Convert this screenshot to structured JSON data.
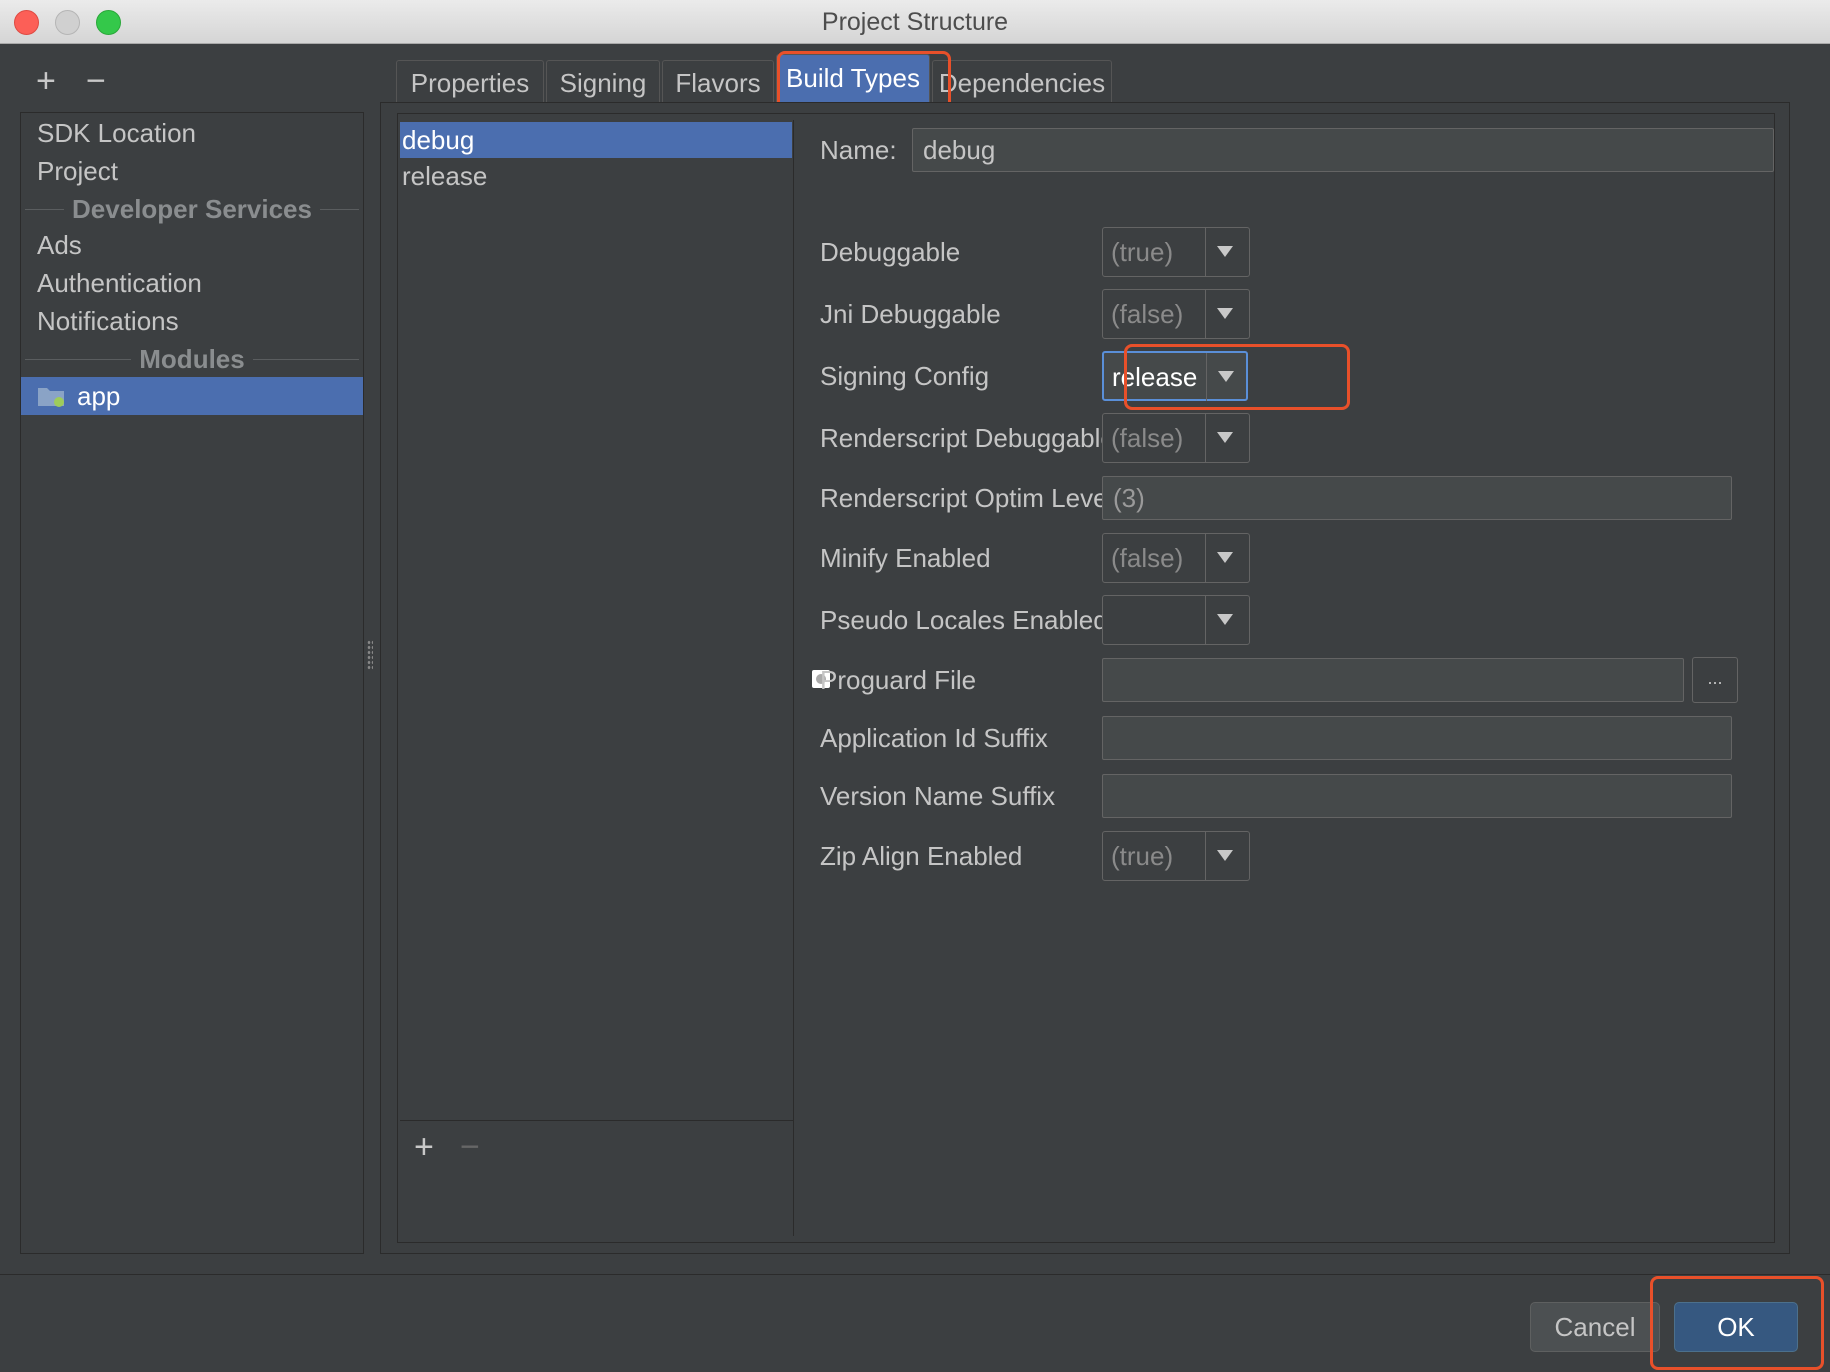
{
  "window": {
    "title": "Project Structure"
  },
  "sidebar": {
    "add_label": "+",
    "remove_label": "−",
    "items": [
      {
        "label": "SDK Location"
      },
      {
        "label": "Project"
      }
    ],
    "section_developer": "Developer Services",
    "developer_items": [
      {
        "label": "Ads"
      },
      {
        "label": "Authentication"
      },
      {
        "label": "Notifications"
      }
    ],
    "section_modules": "Modules",
    "modules": [
      {
        "label": "app",
        "icon": "folder-module-icon"
      }
    ]
  },
  "tabs": [
    {
      "label": "Properties"
    },
    {
      "label": "Signing"
    },
    {
      "label": "Flavors"
    },
    {
      "label": "Build Types",
      "active": true
    },
    {
      "label": "Dependencies"
    }
  ],
  "build_types": {
    "items": [
      {
        "label": "debug",
        "selected": true
      },
      {
        "label": "release"
      }
    ],
    "add_label": "+",
    "remove_label": "−"
  },
  "form": {
    "name_label": "Name:",
    "name_value": "debug",
    "debuggable_label": "Debuggable",
    "debuggable_value": "(true)",
    "jni_label": "Jni Debuggable",
    "jni_value": "(false)",
    "signing_label": "Signing Config",
    "signing_value": "release",
    "rs_debug_label": "Renderscript Debuggable",
    "rs_debug_value": "(false)",
    "rs_optim_label": "Renderscript Optim Level",
    "rs_optim_value": "(3)",
    "minify_label": "Minify Enabled",
    "minify_value": "(false)",
    "pseudo_label": "Pseudo Locales Enabled",
    "pseudo_value": "",
    "proguard_label": "Proguard File",
    "proguard_value": "",
    "browse_label": "...",
    "appid_label": "Application Id Suffix",
    "appid_value": "",
    "version_label": "Version Name Suffix",
    "version_value": "",
    "zipalign_label": "Zip Align Enabled",
    "zipalign_value": "(true)"
  },
  "buttons": {
    "cancel": "Cancel",
    "ok": "OK"
  },
  "colors": {
    "highlight": "#e8502a",
    "selection": "#4b6eaf",
    "background": "#3c3f41"
  }
}
